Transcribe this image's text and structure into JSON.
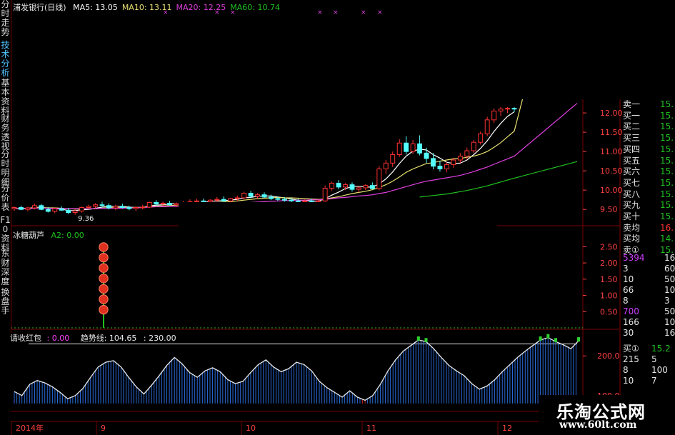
{
  "colors": {
    "up": "#ff3232",
    "down": "#54ffff",
    "ma5": "#ffffff",
    "ma10": "#e8e070",
    "ma20": "#e040e0",
    "ma60": "#20c020",
    "grid": "#7a0000",
    "axis_text": "#ff4040"
  },
  "sidebar": {
    "tabs": [
      {
        "label": "分时走势",
        "active": false
      },
      {
        "label": "技术分析",
        "active": true
      },
      {
        "label": "基本资料",
        "active": false
      },
      {
        "label": "财务透视",
        "active": false
      },
      {
        "label": "分时明细",
        "active": false
      },
      {
        "label": "分价表",
        "active": false
      },
      {
        "label": "F10资料",
        "active": false
      },
      {
        "label": "东财深度",
        "active": false
      },
      {
        "label": "换盘手",
        "active": false
      }
    ]
  },
  "price_panel": {
    "title": "浦发银行(日线)",
    "ma_labels": [
      {
        "text": "MA5: 13.05",
        "color": "#ffffff"
      },
      {
        "text": "MA10: 13.11",
        "color": "#e8e070"
      },
      {
        "text": "MA20: 12.25",
        "color": "#e040e0"
      },
      {
        "text": "MA60: 10.74",
        "color": "#20c020"
      }
    ],
    "low_marker": "9.36"
  },
  "signal_panel": {
    "title": "冰糖葫芦",
    "value_label": "A2: 0.00"
  },
  "trend_panel": {
    "label1": "请收红包",
    "value1": ": 0.00",
    "label2": "趋势线: 104.65",
    "value2": ": 230.00"
  },
  "x_axis": {
    "labels": [
      "2014年",
      "9",
      "10",
      "11",
      "12"
    ]
  },
  "order_book": {
    "rows": [
      {
        "label": "卖一",
        "value": "15.",
        "vcolor": "#20c020"
      },
      {
        "label": "买一",
        "value": "15.",
        "vcolor": "#20c020"
      },
      {
        "label": "买二",
        "value": "15.",
        "vcolor": "#20c020"
      },
      {
        "label": "买三",
        "value": "15.",
        "vcolor": "#20c020"
      },
      {
        "label": "买四",
        "value": "15.",
        "vcolor": "#20c020"
      },
      {
        "label": "买五",
        "value": "15.",
        "vcolor": "#20c020"
      },
      {
        "label": "买六",
        "value": "15.",
        "vcolor": "#20c020"
      },
      {
        "label": "买七",
        "value": "15.",
        "vcolor": "#20c020"
      },
      {
        "label": "买八",
        "value": "15.",
        "vcolor": "#20c020"
      },
      {
        "label": "买九",
        "value": "15.",
        "vcolor": "#20c020"
      },
      {
        "label": "买十",
        "value": "15.",
        "vcolor": "#20c020"
      },
      {
        "label": "卖均",
        "value": "16.",
        "vcolor": "#ff3232"
      },
      {
        "label": "买均",
        "value": "14.",
        "vcolor": "#20c020"
      },
      {
        "label": "卖①",
        "value": "15.",
        "vcolor": "#20c020"
      }
    ],
    "volumes": [
      {
        "left": "5394",
        "right": "16",
        "lcolor": "#d040ff"
      },
      {
        "left": "3",
        "right": "60",
        "lcolor": "#e8e8e8"
      },
      {
        "left": "10",
        "right": "50",
        "lcolor": "#e8e8e8"
      },
      {
        "left": "66",
        "right": "10",
        "lcolor": "#e8e8e8"
      },
      {
        "left": "8",
        "right": "3",
        "lcolor": "#e8e8e8"
      },
      {
        "left": "700",
        "right": "50",
        "lcolor": "#d040ff"
      },
      {
        "left": "166",
        "right": "10",
        "lcolor": "#e8e8e8"
      },
      {
        "left": "30",
        "right": "16",
        "lcolor": "#e8e8e8"
      }
    ],
    "buy_block": [
      {
        "left": "买①",
        "right": "15.2",
        "lcolor": "#e8e8e8",
        "rcolor": "#20c020"
      },
      {
        "left": "215",
        "right": "5",
        "lcolor": "#e8e8e8",
        "rcolor": "#e8e8e8"
      },
      {
        "left": "8",
        "right": "100",
        "lcolor": "#e8e8e8",
        "rcolor": "#e8e8e8"
      },
      {
        "left": "10",
        "right": "7",
        "lcolor": "#e8e8e8",
        "rcolor": "#e8e8e8"
      }
    ]
  },
  "watermark": {
    "title": "乐淘公式网",
    "url": "www.60lt.com"
  },
  "chart_data": [
    {
      "type": "candlestick",
      "title": "浦发银行(日线)",
      "ylim": [
        9.3,
        12.15
      ],
      "yticks": [
        9.5,
        10.0,
        10.5,
        11.0,
        11.5,
        12.0
      ],
      "candles": [
        [
          9.52,
          9.58,
          9.46,
          9.55
        ],
        [
          9.55,
          9.6,
          9.48,
          9.5
        ],
        [
          9.5,
          9.57,
          9.45,
          9.54
        ],
        [
          9.54,
          9.65,
          9.5,
          9.6
        ],
        [
          9.6,
          9.64,
          9.48,
          9.5
        ],
        [
          9.5,
          9.56,
          9.42,
          9.45
        ],
        [
          9.45,
          9.55,
          9.4,
          9.52
        ],
        [
          9.52,
          9.58,
          9.46,
          9.48
        ],
        [
          9.48,
          9.54,
          9.38,
          9.42
        ],
        [
          9.42,
          9.5,
          9.36,
          9.46
        ],
        [
          9.46,
          9.58,
          9.42,
          9.55
        ],
        [
          9.55,
          9.62,
          9.5,
          9.58
        ],
        [
          9.58,
          9.66,
          9.52,
          9.62
        ],
        [
          9.62,
          9.7,
          9.56,
          9.6
        ],
        [
          9.6,
          9.66,
          9.5,
          9.54
        ],
        [
          9.54,
          9.62,
          9.48,
          9.58
        ],
        [
          9.58,
          9.65,
          9.52,
          9.55
        ],
        [
          9.55,
          9.6,
          9.48,
          9.52
        ],
        [
          9.52,
          9.58,
          9.46,
          9.55
        ],
        [
          9.55,
          9.62,
          9.5,
          9.56
        ],
        [
          9.56,
          9.7,
          9.54,
          9.68
        ],
        [
          9.68,
          9.74,
          9.6,
          9.64
        ],
        [
          9.64,
          9.7,
          9.58,
          9.66
        ],
        [
          9.66,
          9.72,
          9.6,
          9.62
        ],
        [
          9.62,
          9.68,
          9.56,
          9.65
        ],
        [
          9.65,
          9.72,
          9.6,
          9.68
        ],
        [
          9.68,
          9.76,
          9.62,
          9.7
        ],
        [
          9.7,
          9.78,
          9.64,
          9.72
        ],
        [
          9.72,
          9.78,
          9.66,
          9.7
        ],
        [
          9.7,
          9.76,
          9.64,
          9.74
        ],
        [
          9.74,
          9.82,
          9.68,
          9.76
        ],
        [
          9.76,
          9.84,
          9.7,
          9.72
        ],
        [
          9.72,
          9.8,
          9.66,
          9.78
        ],
        [
          9.78,
          9.86,
          9.72,
          9.8
        ],
        [
          9.8,
          9.96,
          9.76,
          9.92
        ],
        [
          9.92,
          9.98,
          9.8,
          9.84
        ],
        [
          9.84,
          9.92,
          9.78,
          9.88
        ],
        [
          9.88,
          9.94,
          9.8,
          9.82
        ],
        [
          9.82,
          9.88,
          9.74,
          9.78
        ],
        [
          9.78,
          9.84,
          9.72,
          9.76
        ],
        [
          9.76,
          9.82,
          9.7,
          9.74
        ],
        [
          9.74,
          9.8,
          9.68,
          9.72
        ],
        [
          9.72,
          9.78,
          9.66,
          9.7
        ],
        [
          9.7,
          9.76,
          9.66,
          9.72
        ],
        [
          9.72,
          9.78,
          9.66,
          9.7
        ],
        [
          9.7,
          9.76,
          9.64,
          9.72
        ],
        [
          9.72,
          10.12,
          9.7,
          10.05
        ],
        [
          10.05,
          10.22,
          9.98,
          10.18
        ],
        [
          10.18,
          10.26,
          10.02,
          10.08
        ],
        [
          10.08,
          10.18,
          10.0,
          10.14
        ],
        [
          10.14,
          10.2,
          9.96,
          10.02
        ],
        [
          10.02,
          10.1,
          9.94,
          10.06
        ],
        [
          10.06,
          10.16,
          10.0,
          10.12
        ],
        [
          10.12,
          10.2,
          10.02,
          10.04
        ],
        [
          10.04,
          10.62,
          10.0,
          10.55
        ],
        [
          10.55,
          10.78,
          10.42,
          10.7
        ],
        [
          10.7,
          11.0,
          10.6,
          10.92
        ],
        [
          10.92,
          11.32,
          10.86,
          11.22
        ],
        [
          11.22,
          11.4,
          10.92,
          11.0
        ],
        [
          11.0,
          11.3,
          10.94,
          11.2
        ],
        [
          11.2,
          11.42,
          10.9,
          10.96
        ],
        [
          10.96,
          11.1,
          10.7,
          10.82
        ],
        [
          10.82,
          10.96,
          10.54,
          10.62
        ],
        [
          10.62,
          10.76,
          10.48,
          10.55
        ],
        [
          10.55,
          10.72,
          10.46,
          10.66
        ],
        [
          10.66,
          10.84,
          10.58,
          10.78
        ],
        [
          10.78,
          10.96,
          10.7,
          10.88
        ],
        [
          10.88,
          11.1,
          10.8,
          11.02
        ],
        [
          11.02,
          11.3,
          10.96,
          11.24
        ],
        [
          11.24,
          11.52,
          11.18,
          11.46
        ],
        [
          11.46,
          11.9,
          11.4,
          11.82
        ],
        [
          11.82,
          12.12,
          11.74,
          12.05
        ],
        [
          12.05,
          12.15,
          11.92,
          12.1
        ],
        [
          12.1,
          12.15,
          12.0,
          12.12
        ],
        [
          12.12,
          12.15,
          12.02,
          12.1
        ]
      ],
      "series": [
        {
          "name": "MA5",
          "values": [
            9.52,
            9.53,
            9.53,
            9.55,
            9.56,
            9.53,
            9.52,
            9.51,
            9.47,
            9.47,
            9.49,
            9.5,
            9.53,
            9.56,
            9.58,
            9.58,
            9.58,
            9.56,
            9.55,
            9.55,
            9.59,
            9.61,
            9.62,
            9.64,
            9.65,
            9.65,
            9.66,
            9.67,
            9.68,
            9.71,
            9.72,
            9.73,
            9.74,
            9.76,
            9.8,
            9.81,
            9.84,
            9.85,
            9.85,
            9.82,
            9.8,
            9.77,
            9.74,
            9.73,
            9.72,
            9.71,
            9.78,
            9.87,
            9.95,
            10.04,
            10.09,
            10.1,
            10.08,
            10.08,
            10.16,
            10.29,
            10.47,
            10.69,
            10.88,
            11.01,
            11.06,
            11.04,
            10.92,
            10.83,
            10.72,
            10.69,
            10.7,
            10.78,
            10.92,
            11.08,
            11.28,
            11.52,
            11.73,
            11.91,
            12.03
          ]
        },
        {
          "name": "MA10",
          "values": [
            9.52,
            9.52,
            9.53,
            9.54,
            9.55,
            9.54,
            9.54,
            9.53,
            9.52,
            9.51,
            9.51,
            9.51,
            9.52,
            9.53,
            9.55,
            9.54,
            9.55,
            9.55,
            9.55,
            9.56,
            9.58,
            9.59,
            9.59,
            9.6,
            9.61,
            9.62,
            9.63,
            9.65,
            9.66,
            9.67,
            9.68,
            9.69,
            9.7,
            9.72,
            9.74,
            9.76,
            9.78,
            9.79,
            9.8,
            9.81,
            9.8,
            9.8,
            9.79,
            9.78,
            9.77,
            9.76,
            9.77,
            9.8,
            9.83,
            9.87,
            9.91,
            9.94,
            9.97,
            10.01,
            10.07,
            10.14,
            10.23,
            10.34,
            10.46,
            10.55,
            10.62,
            10.69,
            10.71,
            10.75,
            10.78,
            10.81,
            10.82,
            10.85,
            10.88,
            10.93,
            11.0,
            11.11,
            11.23,
            11.38,
            11.53
          ]
        },
        {
          "name": "MA20",
          "values": [
            9.52,
            9.52,
            9.52,
            9.53,
            9.54,
            9.53,
            9.53,
            9.53,
            9.52,
            9.52,
            9.52,
            9.52,
            9.52,
            9.53,
            9.53,
            9.53,
            9.53,
            9.54,
            9.54,
            9.55,
            9.56,
            9.57,
            9.57,
            9.58,
            9.58,
            9.59,
            9.6,
            9.61,
            9.62,
            9.62,
            9.63,
            9.64,
            9.65,
            9.66,
            9.67,
            9.68,
            9.69,
            9.7,
            9.71,
            9.72,
            9.73,
            9.73,
            9.74,
            9.74,
            9.75,
            9.75,
            9.76,
            9.78,
            9.8,
            9.81,
            9.83,
            9.85,
            9.86,
            9.88,
            9.91,
            9.94,
            9.99,
            10.04,
            10.09,
            10.14,
            10.19,
            10.23,
            10.26,
            10.29,
            10.32,
            10.35,
            10.38,
            10.43,
            10.48,
            10.54,
            10.6,
            10.67,
            10.74,
            10.81,
            10.88
          ]
        },
        {
          "name": "MA60",
          "values": [
            null,
            null,
            null,
            null,
            null,
            null,
            null,
            null,
            null,
            null,
            null,
            null,
            null,
            null,
            null,
            null,
            null,
            null,
            null,
            null,
            null,
            null,
            null,
            null,
            null,
            null,
            null,
            null,
            null,
            null,
            null,
            null,
            null,
            null,
            null,
            null,
            null,
            null,
            null,
            null,
            null,
            null,
            null,
            null,
            null,
            null,
            null,
            null,
            null,
            null,
            null,
            null,
            null,
            null,
            null,
            null,
            null,
            null,
            null,
            null,
            9.82,
            9.84,
            9.86,
            9.88,
            9.9,
            9.93,
            9.96,
            9.99,
            10.03,
            10.07,
            10.11,
            10.16,
            10.21,
            10.26,
            10.31
          ]
        }
      ]
    },
    {
      "type": "bar",
      "title": "冰糖葫芦",
      "ylim": [
        0,
        2.75
      ],
      "yticks": [
        0.5,
        1.0,
        1.5,
        2.0,
        2.5
      ],
      "signal_index": 14,
      "signal_beads": 7
    },
    {
      "type": "bar",
      "title": "请收红包",
      "ylim": [
        60,
        240
      ],
      "yticks": [
        100.0,
        200.0
      ],
      "reference_line": 230,
      "values": [
        110,
        100,
        128,
        138,
        132,
        122,
        108,
        92,
        100,
        118,
        146,
        172,
        184,
        188,
        172,
        146,
        122,
        104,
        126,
        150,
        176,
        196,
        180,
        158,
        146,
        162,
        170,
        160,
        140,
        130,
        136,
        158,
        178,
        190,
        172,
        160,
        168,
        184,
        178,
        162,
        136,
        120,
        108,
        96,
        112,
        96,
        88,
        100,
        128,
        162,
        190,
        212,
        226,
        240,
        236,
        218,
        196,
        176,
        162,
        150,
        130,
        116,
        124,
        140,
        160,
        178,
        196,
        212,
        226,
        240,
        246,
        236,
        228,
        218,
        238
      ]
    }
  ]
}
